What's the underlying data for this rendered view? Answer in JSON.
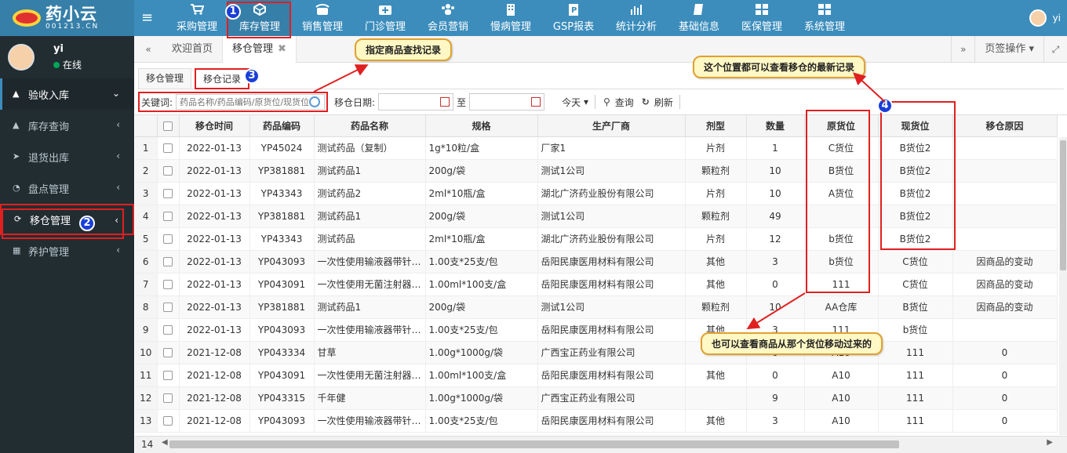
{
  "app": {
    "logo_text": "药小云",
    "logo_sub": "001213.CN",
    "top_nav": [
      {
        "label": "采购管理",
        "icon": "cart-icon"
      },
      {
        "label": "库存管理",
        "icon": "cube-icon"
      },
      {
        "label": "销售管理",
        "icon": "phone-icon"
      },
      {
        "label": "门诊管理",
        "icon": "medkit-icon"
      },
      {
        "label": "会员营销",
        "icon": "users-icon"
      },
      {
        "label": "慢病管理",
        "icon": "building-icon"
      },
      {
        "label": "GSP报表",
        "icon": "report-icon"
      },
      {
        "label": "统计分析",
        "icon": "bar-chart-icon"
      },
      {
        "label": "基础信息",
        "icon": "book-icon"
      },
      {
        "label": "医保管理",
        "icon": "windows-icon"
      },
      {
        "label": "系统管理",
        "icon": "windows-icon"
      }
    ],
    "user": "yi"
  },
  "sidebar": {
    "user_name": "yi",
    "status": "在线",
    "items": [
      {
        "label": "验收入库",
        "icon": "chart-icon",
        "arrow": "⌄"
      },
      {
        "label": "库存查询",
        "icon": "chart-icon",
        "arrow": "‹"
      },
      {
        "label": "退货出库",
        "icon": "send-icon",
        "arrow": "‹"
      },
      {
        "label": "盘点管理",
        "icon": "pie-icon",
        "arrow": "‹"
      },
      {
        "label": "移仓管理",
        "icon": "refresh-icon",
        "arrow": "‹"
      },
      {
        "label": "养护管理",
        "icon": "grid-icon",
        "arrow": "‹"
      }
    ]
  },
  "tabs": {
    "items": [
      {
        "label": "欢迎首页"
      },
      {
        "label": "移仓管理"
      }
    ],
    "page_ops": "页签操作"
  },
  "subtabs": [
    {
      "label": "移仓管理"
    },
    {
      "label": "移仓记录"
    }
  ],
  "toolbar": {
    "keyword_label": "关键词:",
    "keyword_placeholder": "药品名称/药品编码/原货位/现货位",
    "date_label": "移仓日期:",
    "to_label": "至",
    "today": "今天",
    "query": "查询",
    "refresh": "刷新"
  },
  "table": {
    "headers": [
      "",
      "",
      "移仓时间",
      "药品编码",
      "药品名称",
      "规格",
      "生产厂商",
      "剂型",
      "数量",
      "原货位",
      "现货位",
      "移仓原因"
    ],
    "rows": [
      [
        "1",
        "2022-01-13",
        "YP45024",
        "测试药品（复制）",
        "1g*10粒/盒",
        "厂家1",
        "片剂",
        "1",
        "C货位",
        "B货位2",
        ""
      ],
      [
        "2",
        "2022-01-13",
        "YP381881",
        "测试药品1",
        "200g/袋",
        "测试1公司",
        "颗粒剂",
        "10",
        "B货位",
        "B货位2",
        ""
      ],
      [
        "3",
        "2022-01-13",
        "YP43343",
        "测试药品2",
        "2ml*10瓶/盒",
        "湖北广济药业股份有限公司",
        "片剂",
        "10",
        "A货位",
        "B货位2",
        ""
      ],
      [
        "4",
        "2022-01-13",
        "YP381881",
        "测试药品1",
        "200g/袋",
        "测试1公司",
        "颗粒剂",
        "49",
        "",
        "B货位2",
        ""
      ],
      [
        "5",
        "2022-01-13",
        "YP43343",
        "测试药品",
        "2ml*10瓶/盒",
        "湖北广济药业股份有限公司",
        "片剂",
        "12",
        "b货位",
        "B货位2",
        ""
      ],
      [
        "6",
        "2022-01-13",
        "YP043093",
        "一次性使用输液器带针…",
        "1.00支*25支/包",
        "岳阳民康医用材料有限公司",
        "其他",
        "3",
        "b货位",
        "C货位",
        "因商品的变动"
      ],
      [
        "7",
        "2022-01-13",
        "YP043091",
        "一次性使用无菌注射器…",
        "1.00ml*100支/盒",
        "岳阳民康医用材料有限公司",
        "其他",
        "0",
        "111",
        "C货位",
        "因商品的变动"
      ],
      [
        "8",
        "2022-01-13",
        "YP381881",
        "测试药品1",
        "200g/袋",
        "测试1公司",
        "颗粒剂",
        "10",
        "AA仓库",
        "B货位",
        "因商品的变动"
      ],
      [
        "9",
        "2022-01-13",
        "YP043093",
        "一次性使用输液器带针…",
        "1.00支*25支/包",
        "岳阳民康医用材料有限公司",
        "其他",
        "3",
        "111",
        "b货位",
        ""
      ],
      [
        "10",
        "2021-12-08",
        "YP043334",
        "甘草",
        "1.00g*1000g/袋",
        "广西宝正药业有限公司",
        "",
        "0",
        "A10",
        "111",
        "0"
      ],
      [
        "11",
        "2021-12-08",
        "YP043091",
        "一次性使用无菌注射器…",
        "1.00ml*100支/盒",
        "岳阳民康医用材料有限公司",
        "其他",
        "0",
        "A10",
        "111",
        "0"
      ],
      [
        "12",
        "2021-12-08",
        "YP043315",
        "千年健",
        "1.00g*1000g/袋",
        "广西宝正药业有限公司",
        "",
        "9",
        "A10",
        "111",
        "0"
      ],
      [
        "13",
        "2021-12-08",
        "YP043093",
        "一次性使用输液器带针…",
        "1.00支*25支/包",
        "岳阳民康医用材料有限公司",
        "其他",
        "3",
        "A10",
        "111",
        "0"
      ]
    ],
    "footer_row": "14"
  },
  "annotations": {
    "badges": [
      "1",
      "2",
      "3",
      "4"
    ],
    "callout_search": "指定商品查找记录",
    "callout_latest": "这个位置都可以查看移仓的最新记录",
    "callout_from": "也可以查看商品从那个货位移动过来的",
    "accent": "#e02020",
    "badge_color": "#1a3fd8"
  }
}
